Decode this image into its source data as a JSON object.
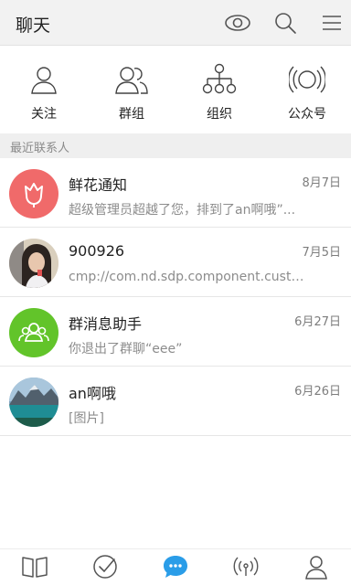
{
  "header": {
    "title": "聊天",
    "icons": [
      "eye-icon",
      "search-icon",
      "menu-icon"
    ]
  },
  "quick_actions": [
    {
      "label": "关注",
      "icon": "person-icon"
    },
    {
      "label": "群组",
      "icon": "group-icon"
    },
    {
      "label": "组织",
      "icon": "org-chart-icon"
    },
    {
      "label": "公众号",
      "icon": "broadcast-icon"
    }
  ],
  "section": {
    "title": "最近联系人"
  },
  "conversations": [
    {
      "name": "鲜花通知",
      "date": "8月7日",
      "preview": "超级管理员超越了您，排到了an啊哦”...",
      "avatar": "flower-avatar",
      "avatar_color": "#f06a6a"
    },
    {
      "name": "900926",
      "date": "7月5日",
      "preview": "cmp://com.nd.sdp.component.custo...",
      "avatar": "photo-avatar"
    },
    {
      "name": "群消息助手",
      "date": "6月27日",
      "preview": "你退出了群聊“eee”",
      "avatar": "group-avatar",
      "avatar_color": "#62c42a"
    },
    {
      "name": "an啊哦",
      "date": "6月26日",
      "preview": "[图片]",
      "avatar": "landscape-avatar"
    }
  ],
  "bottom_nav": [
    {
      "icon": "book-icon"
    },
    {
      "icon": "check-icon"
    },
    {
      "icon": "chat-icon",
      "active": true
    },
    {
      "icon": "signal-icon"
    },
    {
      "icon": "profile-icon"
    }
  ],
  "colors": {
    "accent": "#2a9de8",
    "header_bg": "#f2f2f2",
    "section_bg": "#efefef"
  }
}
